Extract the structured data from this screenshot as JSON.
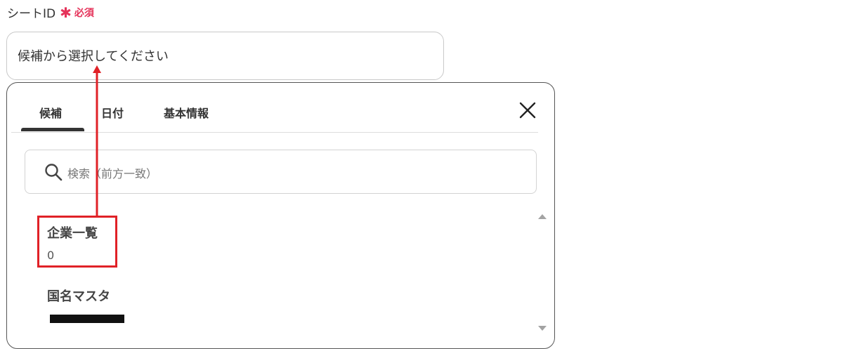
{
  "field": {
    "label": "シートID",
    "asterisk": "✱",
    "required_label": "必須",
    "placeholder": "候補から選択してください"
  },
  "dropdown": {
    "tabs": [
      {
        "label": "候補",
        "active": true
      },
      {
        "label": "日付",
        "active": false
      },
      {
        "label": "基本情報",
        "active": false
      }
    ],
    "search_placeholder": "検索（前方一致）",
    "items": [
      {
        "title": "企業一覧",
        "subtitle": "0"
      },
      {
        "title": "国名マスタ",
        "subtitle_redacted": true
      }
    ]
  },
  "icons": {
    "close": "close-icon",
    "search": "search-icon"
  },
  "colors": {
    "accent_required": "#e5335a",
    "annotation_red": "#e02127",
    "text": "#333333"
  }
}
